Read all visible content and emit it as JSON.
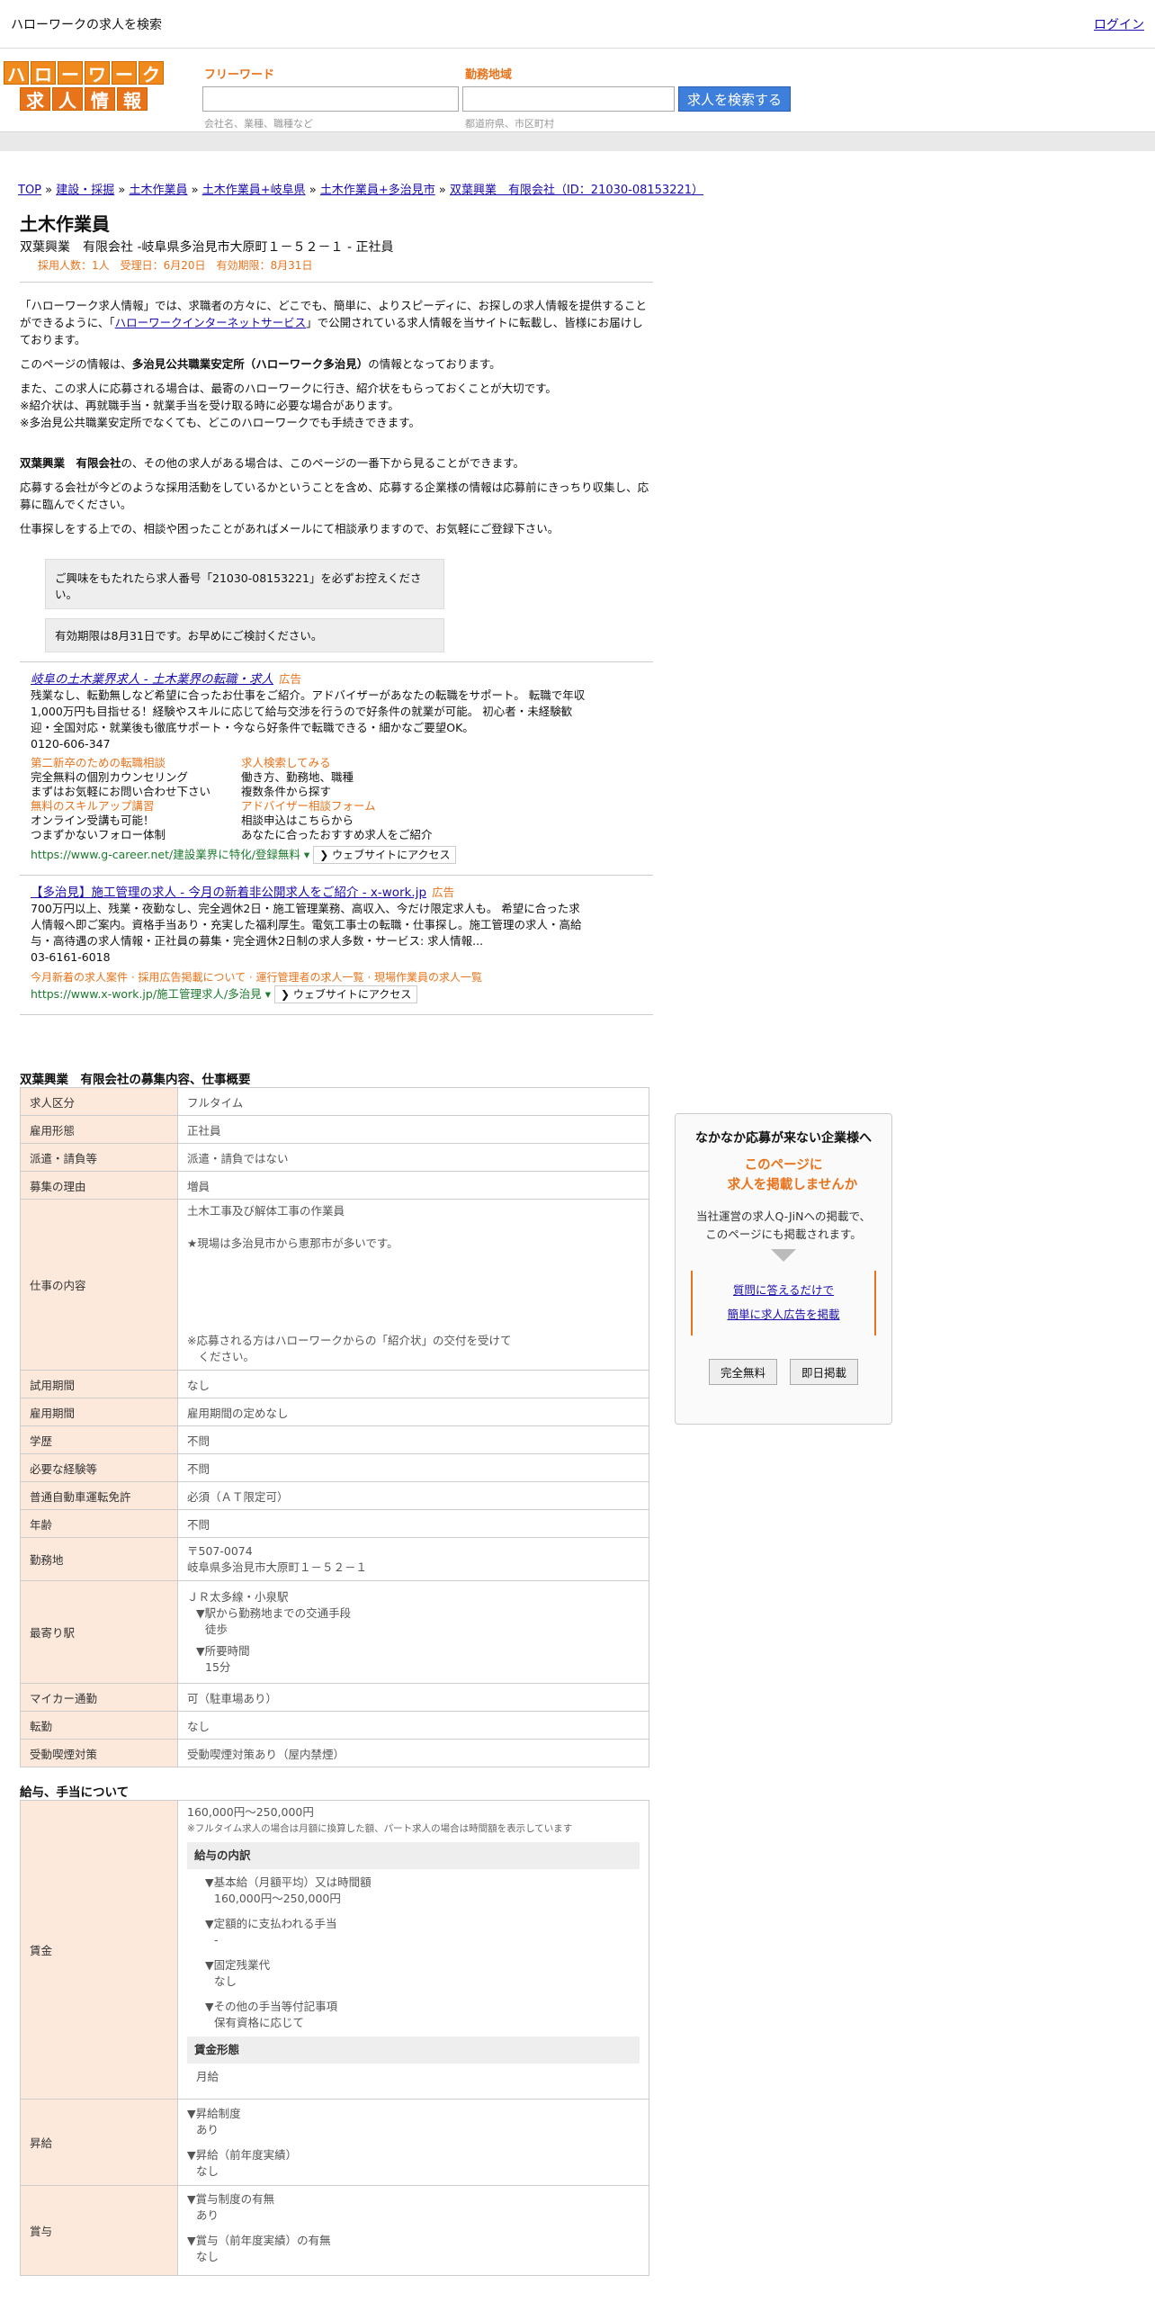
{
  "topbar": {
    "title": "ハローワークの求人を検索",
    "login": "ログイン"
  },
  "logo": {
    "row1": [
      "ハ",
      "ロ",
      "ー",
      "ワ",
      "ー",
      "ク"
    ],
    "row2": [
      "求",
      "人",
      "情",
      "報"
    ]
  },
  "search": {
    "freeword_label": "フリーワード",
    "freeword_hint": "会社名、業種、職種など",
    "area_label": "勤務地域",
    "area_hint": "都道府県、市区町村",
    "button": "求人を検索する"
  },
  "breadcrumb": [
    "TOP",
    "建設・採掘",
    "土木作業員",
    "土木作業員+岐阜県",
    "土木作業員+多治見市",
    "双葉興業　有限会社（ID：21030-08153221）"
  ],
  "job": {
    "title": "土木作業員",
    "company_line": "双葉興業　有限会社 -岐阜県多治見市大原町１－５２－１ - 正社員",
    "meta": "採用人数：1人　受理日：6月20日　有効期限：8月31日"
  },
  "intro": {
    "p1a": "「ハローワーク求人情報」では、求職者の方々に、どこでも、簡単に、よりスピーディに、お探しの求人情報を提供することができるように、「",
    "p1link": "ハローワークインターネットサービス",
    "p1b": "」で公開されている求人情報を当サイトに転載し、皆様にお届けしております。",
    "p2a": "このページの情報は、",
    "p2b": "多治見公共職業安定所（ハローワーク多治見）",
    "p2c": "の情報となっております。",
    "p3": [
      "また、この求人に応募される場合は、最寄のハローワークに行き、紹介状をもらっておくことが大切です。",
      "※紹介状は、再就職手当・就業手当を受け取る時に必要な場合があります。",
      "※多治見公共職業安定所でなくても、どこのハローワークでも手続きできます。"
    ],
    "p4a": "双葉興業　有限会社",
    "p4b": "の、その他の求人がある場合は、このページの一番下から見ることができます。",
    "p5": "応募する会社が今どのような採用活動をしているかということを含め、応募する企業様の情報は応募前にきっちり収集し、応募に臨んでください。",
    "p6": "仕事探しをする上での、相談や困ったことがあればメールにて相談承りますので、お気軽にご登録下さい。",
    "box1": "ご興味をもたれたら求人番号「21030-08153221」を必ずお控えください。",
    "box2": "有効期限は8月31日です。お早めにご検討ください。"
  },
  "ad1": {
    "headline": "岐阜の土木業界求人 - 土木業界の転職・求人",
    "tag": "広告",
    "desc": "残業なし、転勤無しなど希望に合ったお仕事をご紹介。アドバイザーがあなたの転職をサポート。 転職で年収1,000万円も目指せる！経験やスキルに応じて給与交渉を行うので好条件の就業が可能。 初心者・未経験歓迎・全国対応・就業後も徹底サポート・今なら好条件で転職できる・細かなご要望OK。",
    "phone": "0120-606-347",
    "sitelinks": [
      {
        "title": "第二新卒のための転職相談",
        "l1": "完全無料の個別カウンセリング",
        "l2": "まずはお気軽にお問い合わせ下さい"
      },
      {
        "title": "求人検索してみる",
        "l1": "働き方、勤務地、職種",
        "l2": "複数条件から探す"
      },
      {
        "title": "無料のスキルアップ講習",
        "l1": "オンライン受講も可能！",
        "l2": "つまずかないフォロー体制"
      },
      {
        "title": "アドバイザー相談フォーム",
        "l1": "相談申込はこちらから",
        "l2": "あなたに合ったおすすめ求人をご紹介"
      }
    ],
    "url": "https://www.g-career.net/建設業界に特化/登録無料",
    "visit": "ウェブサイトにアクセス"
  },
  "ad2": {
    "headline": "【多治見】施工管理の求人 - 今月の新着非公開求人をご紹介 - x-work.jp",
    "tag": "広告",
    "desc": "700万円以上、残業・夜勤なし、完全週休2日・施工管理業務、高収入、今だけ限定求人も。 希望に合った求人情報へ即ご案内。資格手当あり・充実した福利厚生。電気工事士の転職・仕事探し。施工管理の求人・高給与・高待遇の求人情報・正社員の募集・完全週休2日制の求人多数・サービス: 求人情報...",
    "phone": "03-6161-6018",
    "links": "今月新着の求人案件 · 採用広告掲載について · 運行管理者の求人一覧 · 現場作業員の求人一覧",
    "url": "https://www.x-work.jp/施工管理求人/多治見",
    "visit": "ウェブサイトにアクセス"
  },
  "overview": {
    "title": "双葉興業　有限会社の募集内容、仕事概要",
    "rows": [
      {
        "k": "求人区分",
        "v": "フルタイム"
      },
      {
        "k": "雇用形態",
        "v": "正社員"
      },
      {
        "k": "派遣・請負等",
        "v": "派遣・請負ではない"
      },
      {
        "k": "募集の理由",
        "v": "増員"
      },
      {
        "k": "仕事の内容",
        "v1": "土木工事及び解体工事の作業員",
        "v2": "★現場は多治見市から恵那市が多いです。",
        "v3": "※応募される方はハローワークからの「紹介状」の交付を受けて",
        "v4": "　ください。"
      },
      {
        "k": "試用期間",
        "v": "なし"
      },
      {
        "k": "雇用期間",
        "v": "雇用期間の定めなし"
      },
      {
        "k": "学歴",
        "v": "不問"
      },
      {
        "k": "必要な経験等",
        "v": "不問"
      },
      {
        "k": "普通自動車運転免許",
        "v": "必須（ＡＴ限定可）"
      },
      {
        "k": "年齢",
        "v": "不問"
      },
      {
        "k": "勤務地",
        "v1": "〒507-0074",
        "v2": "岐阜県多治見市大原町１－５２－１"
      },
      {
        "k": "最寄り駅",
        "v1": "ＪＲ太多線・小泉駅",
        "v2": "▼駅から勤務地までの交通手段",
        "v3": "徒歩",
        "v4": "▼所要時間",
        "v5": "15分"
      },
      {
        "k": "マイカー通勤",
        "v": "可（駐車場あり）"
      },
      {
        "k": "転勤",
        "v": "なし"
      },
      {
        "k": "受動喫煙対策",
        "v": "受動喫煙対策あり（屋内禁煙）"
      }
    ]
  },
  "salary": {
    "title": "給与、手当について",
    "wage_k": "賃金",
    "range": "160,000円〜250,000円",
    "note": "※フルタイム求人の場合は月額に換算した額、パート求人の場合は時間額を表示しています",
    "breakdown": "給与の内訳",
    "b1": "▼基本給（月額平均）又は時間額",
    "b1v": "160,000円〜250,000円",
    "b2": "▼定額的に支払われる手当",
    "b2v": "-",
    "b3": "▼固定残業代",
    "b3v": "なし",
    "b4": "▼その他の手当等付記事項",
    "b4v": "保有資格に応じて",
    "form": "賃金形態",
    "formv": "月給",
    "raise_k": "昇給",
    "r1": "▼昇給制度",
    "r1v": "あり",
    "r2": "▼昇給（前年度実績）",
    "r2v": "なし",
    "bonus_k": "賞与",
    "s1": "▼賞与制度の有無",
    "s1v": "あり",
    "s2": "▼賞与（前年度実績）の有無",
    "s2v": "なし"
  },
  "sidebox": {
    "title": "なかなか応募が来ない企業様へ",
    "o1": "このページに",
    "o2": "求人を掲載しませんか",
    "t1": "当社運営の求人Q-JiNへの掲載で、",
    "t2": "このページにも掲載されます。",
    "l1": "質問に答えるだけで",
    "l2": "簡単に求人広告を掲載",
    "btn1": "完全無料",
    "btn2": "即日掲載"
  }
}
